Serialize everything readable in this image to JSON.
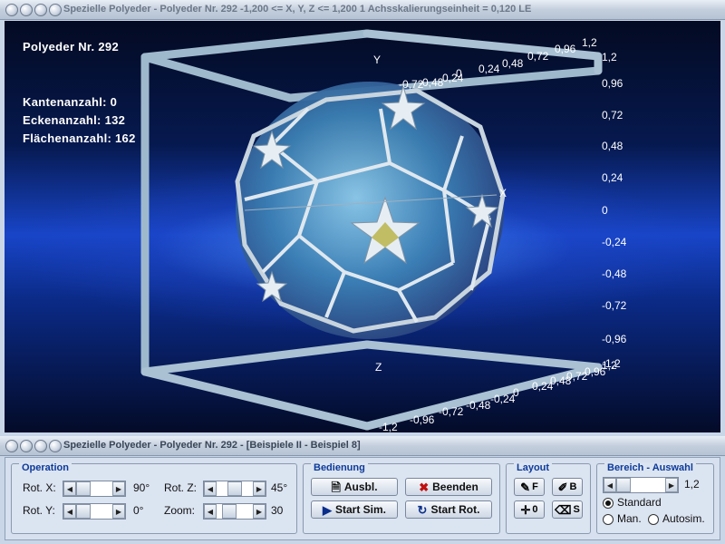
{
  "window": {
    "title": "Spezielle Polyeder - Polyeder Nr. 292   -1,200 <= X, Y, Z <= 1,200    1 Achsskalierungseinheit = 0,120 LE"
  },
  "viewport": {
    "polyeder_label": "Polyeder Nr. 292",
    "kantenanzahl": "Kantenanzahl: 0",
    "eckenanzahl": "Eckenanzahl: 132",
    "flaechenanzahl": "Flächenanzahl: 162",
    "axis_x_label": "X",
    "axis_z_label": "Z",
    "axis_y_label": "Y",
    "vertical_ticks": [
      "1,2",
      "0,96",
      "0,72",
      "0,48",
      "0,24",
      "0",
      "-0,24",
      "-0,48",
      "-0,72",
      "-0,96",
      "-1,2"
    ],
    "top_ticks": [
      "-0,72",
      "-0,48",
      "-0,24",
      "0",
      "0,24",
      "0,48",
      "0,72",
      "0,96",
      "1,2"
    ],
    "bottom_ticks": [
      "-1,2",
      "-0,96",
      "-0,72",
      "-0,48",
      "-0,24",
      "0",
      "0,24",
      "0,48",
      "0,72",
      "0,96",
      "1,2"
    ]
  },
  "panel_window": {
    "title": "Spezielle Polyeder - Polyeder Nr. 292 - [Beispiele II - Beispiel 8]"
  },
  "operation": {
    "title": "Operation",
    "rot_x_label": "Rot. X:",
    "rot_x_value": "90°",
    "rot_y_label": "Rot. Y:",
    "rot_y_value": "0°",
    "rot_z_label": "Rot. Z:",
    "rot_z_value": "45°",
    "zoom_label": "Zoom:",
    "zoom_value": "30"
  },
  "bedienung": {
    "title": "Bedienung",
    "ausbl_label": "Ausbl.",
    "beenden_label": "Beenden",
    "start_sim_label": "Start Sim.",
    "start_rot_label": "Start Rot."
  },
  "layout": {
    "title": "Layout",
    "f_label": "F",
    "b_label": "B",
    "o_label": "0",
    "s_label": "S"
  },
  "bereich": {
    "title": "Bereich - Auswahl",
    "value": "1,2",
    "standard_label": "Standard",
    "man_label": "Man.",
    "autosim_label": "Autosim.",
    "selected": "Standard"
  }
}
